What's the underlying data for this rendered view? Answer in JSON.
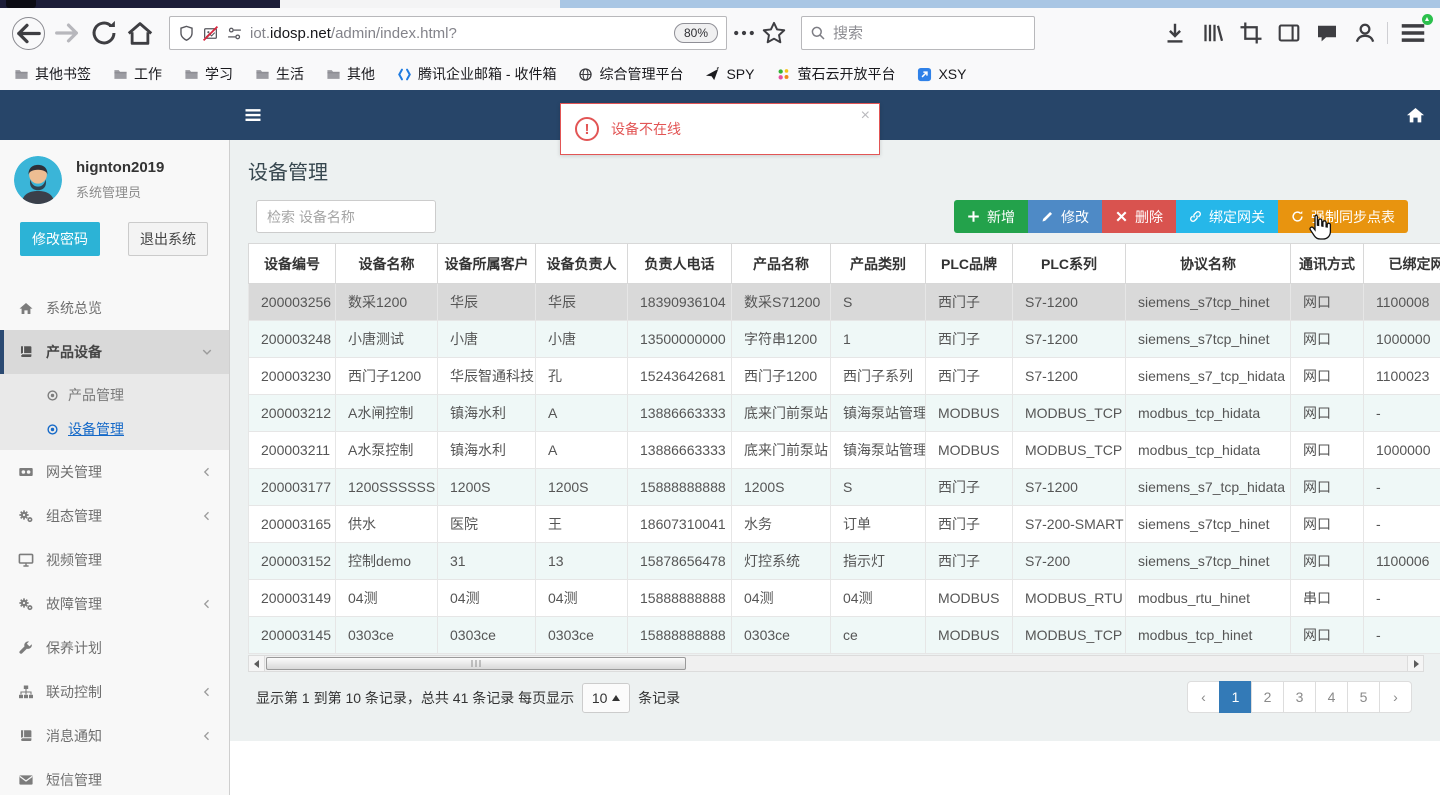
{
  "browser": {
    "url_subdomain": "iot.",
    "url_domain": "idosp.net",
    "url_path": "/admin/index.html?",
    "zoom_level": "80%",
    "search_placeholder": "搜索",
    "bookmarks": [
      {
        "label": "其他书签",
        "icon": "folder"
      },
      {
        "label": "工作",
        "icon": "folder"
      },
      {
        "label": "学习",
        "icon": "folder"
      },
      {
        "label": "生活",
        "icon": "folder"
      },
      {
        "label": "其他",
        "icon": "folder"
      },
      {
        "label": "腾讯企业邮箱 - 收件箱",
        "icon": "tencent"
      },
      {
        "label": "综合管理平台",
        "icon": "globe"
      },
      {
        "label": "SPY",
        "icon": "plane"
      },
      {
        "label": "萤石云开放平台",
        "icon": "dots4"
      },
      {
        "label": "XSY",
        "icon": "xsy"
      }
    ]
  },
  "alert": {
    "message": "设备不在线",
    "close_label": "×"
  },
  "sidebar": {
    "username": "hignton2019",
    "role": "系统管理员",
    "change_password_label": "修改密码",
    "logout_label": "退出系统",
    "menu": [
      {
        "label": "系统总览",
        "icon": "s_home",
        "chevron": ""
      },
      {
        "label": "产品设备",
        "icon": "s_book",
        "chevron": "down",
        "active": true,
        "children": [
          {
            "label": "产品管理",
            "icon": "s_dot",
            "active": false
          },
          {
            "label": "设备管理",
            "icon": "s_dot",
            "active": true
          }
        ]
      },
      {
        "label": "网关管理",
        "icon": "s_video",
        "chevron": "left"
      },
      {
        "label": "组态管理",
        "icon": "s_gears",
        "chevron": "left"
      },
      {
        "label": "视频管理",
        "icon": "s_monitor",
        "chevron": ""
      },
      {
        "label": "故障管理",
        "icon": "s_gears",
        "chevron": "left"
      },
      {
        "label": "保养计划",
        "icon": "s_wrench",
        "chevron": ""
      },
      {
        "label": "联动控制",
        "icon": "s_sitemap",
        "chevron": "left"
      },
      {
        "label": "消息通知",
        "icon": "s_book",
        "chevron": "left"
      },
      {
        "label": "短信管理",
        "icon": "s_envelope",
        "chevron": ""
      }
    ]
  },
  "page": {
    "title": "设备管理"
  },
  "toolbar": {
    "search_placeholder": "检索 设备名称",
    "buttons": [
      {
        "label": "新增",
        "icon": "plus",
        "color": "#23a24b"
      },
      {
        "label": "修改",
        "icon": "pencil",
        "color": "#4e8ac6"
      },
      {
        "label": "删除",
        "icon": "xmark",
        "color": "#d9534f"
      },
      {
        "label": "绑定网关",
        "icon": "link",
        "color": "#26b7e9"
      },
      {
        "label": "强制同步点表",
        "icon": "refresh",
        "color": "#e8940f"
      }
    ]
  },
  "table": {
    "columns": [
      "设备编号",
      "设备名称",
      "设备所属客户",
      "设备负责人",
      "负责人电话",
      "产品名称",
      "产品类别",
      "PLC品牌",
      "PLC系列",
      "协议名称",
      "通讯方式",
      "已绑定网关"
    ],
    "selected_row_index": 0,
    "rows": [
      [
        "200003256",
        "数采1200",
        "华辰",
        "华辰",
        "18390936104",
        "数采S71200",
        "S",
        "西门子",
        "S7-1200",
        "siemens_s7tcp_hinet",
        "网口",
        "1100008"
      ],
      [
        "200003248",
        "小唐测试",
        "小唐",
        "小唐",
        "13500000000",
        "字符串1200",
        "1",
        "西门子",
        "S7-1200",
        "siemens_s7tcp_hinet",
        "网口",
        "1000000"
      ],
      [
        "200003230",
        "西门子1200",
        "华辰智通科技",
        "孔",
        "15243642681",
        "西门子1200",
        "西门子系列",
        "西门子",
        "S7-1200",
        "siemens_s7_tcp_hidata",
        "网口",
        "1100023"
      ],
      [
        "200003212",
        "A水闸控制",
        "镇海水利",
        "A",
        "13886663333",
        "底来门前泵站",
        "镇海泵站管理",
        "MODBUS",
        "MODBUS_TCP",
        "modbus_tcp_hidata",
        "网口",
        "-"
      ],
      [
        "200003211",
        "A水泵控制",
        "镇海水利",
        "A",
        "13886663333",
        "底来门前泵站",
        "镇海泵站管理",
        "MODBUS",
        "MODBUS_TCP",
        "modbus_tcp_hidata",
        "网口",
        "1000000"
      ],
      [
        "200003177",
        "1200SSSSSS",
        "1200S",
        "1200S",
        "15888888888",
        "1200S",
        "S",
        "西门子",
        "S7-1200",
        "siemens_s7_tcp_hidata",
        "网口",
        "-"
      ],
      [
        "200003165",
        "供水",
        "医院",
        "王",
        "18607310041",
        "水务",
        "订单",
        "西门子",
        "S7-200-SMART",
        "siemens_s7tcp_hinet",
        "网口",
        "-"
      ],
      [
        "200003152",
        "控制demo",
        "31",
        "13",
        "15878656478",
        "灯控系统",
        "指示灯",
        "西门子",
        "S7-200",
        "siemens_s7tcp_hinet",
        "网口",
        "1100006"
      ],
      [
        "200003149",
        "04测",
        "04测",
        "04测",
        "15888888888",
        "04测",
        "04测",
        "MODBUS",
        "MODBUS_RTU",
        "modbus_rtu_hinet",
        "串口",
        "-"
      ],
      [
        "200003145",
        "0303ce",
        "0303ce",
        "0303ce",
        "15888888888",
        "0303ce",
        "ce",
        "MODBUS",
        "MODBUS_TCP",
        "modbus_tcp_hinet",
        "网口",
        "-"
      ]
    ]
  },
  "pagination": {
    "info_prefix": "显示第 1 到第 10 条记录，总共 41 条记录 每页显示",
    "page_size": "10",
    "info_suffix": "条记录",
    "prev": "‹",
    "next": "›",
    "pages": [
      "1",
      "2",
      "3",
      "4",
      "5"
    ],
    "active_page": "1"
  },
  "colors": {
    "header_blue": "#274569",
    "alert_red": "#e25555",
    "link_blue": "#1569c8",
    "page_active": "#337ab7",
    "change_password_bg": "#2cb3d6"
  }
}
